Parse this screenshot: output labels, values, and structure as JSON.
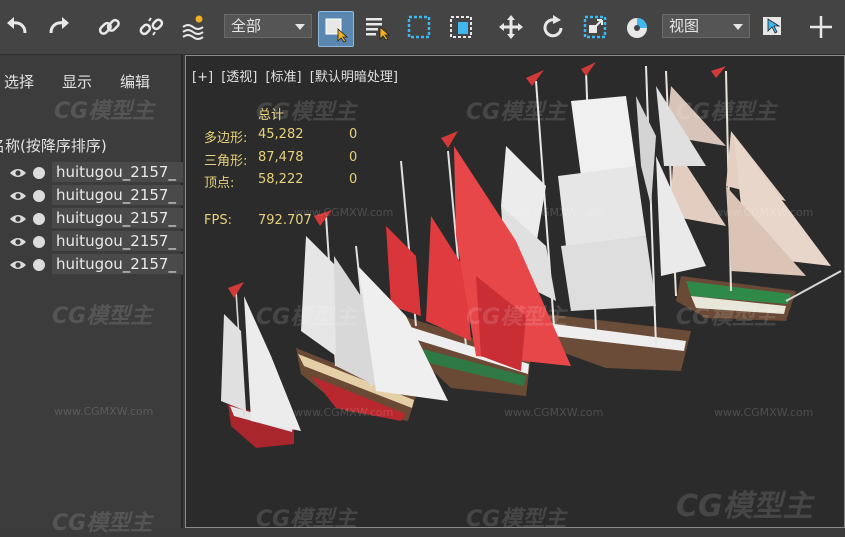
{
  "toolbar": {
    "selection_filter": "全部",
    "reference_coord": "视图",
    "buttons": [
      "undo",
      "redo",
      "link",
      "unlink",
      "bind-space-warp",
      "select-object",
      "select-by-name",
      "rect-selection-region",
      "window-crossing",
      "select-and-move",
      "select-and-rotate",
      "select-and-scale",
      "use-pivot-center",
      "snap-toggle",
      "select-and-manipulate"
    ]
  },
  "explorer": {
    "menu": {
      "select": "选择",
      "display": "显示",
      "edit": "编辑"
    },
    "column_header": "名称(按降序排序)",
    "objects": [
      "huitugou_2157_",
      "huitugou_2157_",
      "huitugou_2157_",
      "huitugou_2157_",
      "huitugou_2157_"
    ]
  },
  "viewport": {
    "label": {
      "plus": "[+]",
      "view": "[透视]",
      "shading": "[标准]",
      "lighting": "[默认明暗处理]"
    },
    "stats": {
      "header": "总计",
      "polygons_label": "多边形:",
      "polygons_value": "45,282",
      "polygons_selected": "0",
      "triangles_label": "三角形:",
      "triangles_value": "87,478",
      "triangles_selected": "0",
      "vertices_label": "顶点:",
      "vertices_value": "58,222",
      "vertices_selected": "0",
      "fps_label": "FPS:",
      "fps_value": "792.707"
    }
  },
  "watermark": {
    "logo": "CG模型主",
    "url": "www.CGMXW.com"
  },
  "colors": {
    "active_button": "#5a87b0",
    "stats_text": "#e6d27a",
    "viewport_bg": "#2b2b2b",
    "panel_bg": "#3c3c3c"
  }
}
